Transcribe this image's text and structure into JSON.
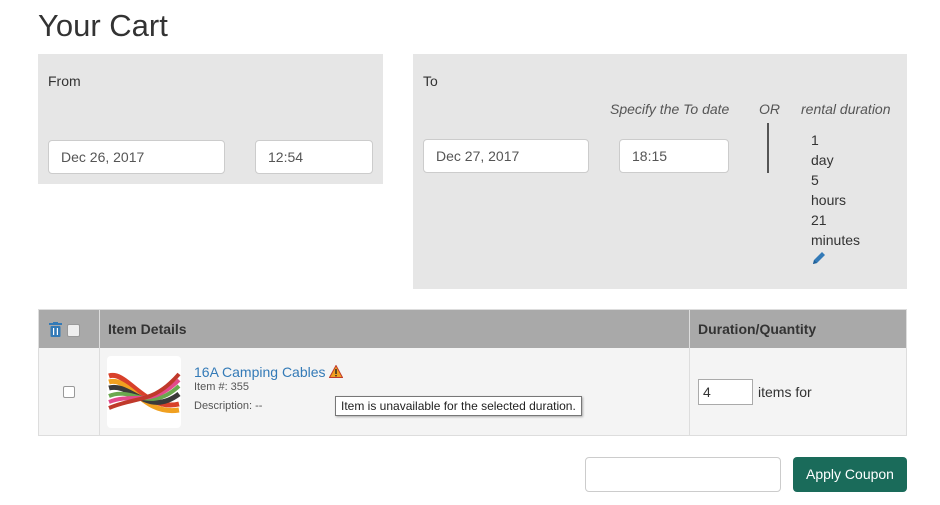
{
  "page": {
    "title": "Your Cart"
  },
  "from": {
    "label": "From",
    "date": "Dec 26, 2017",
    "time": "12:54"
  },
  "to": {
    "label": "To",
    "specify_label": "Specify the To date",
    "or_label": "OR",
    "duration_label": "rental duration",
    "date": "Dec 27, 2017",
    "time": "18:15",
    "duration": [
      "1",
      "day",
      "5",
      "hours",
      "21",
      "minutes"
    ]
  },
  "table": {
    "headers": {
      "details": "Item Details",
      "duration": "Duration/Quantity"
    },
    "rows": [
      {
        "name": "16A Camping Cables",
        "item_no": "Item #: 355",
        "description": "Description: --",
        "tooltip": "Item is unavailable for the selected duration.",
        "quantity": "4",
        "qty_suffix": "items for"
      }
    ]
  },
  "coupon": {
    "value": "",
    "button": "Apply Coupon"
  },
  "colors": {
    "accent": "#1a6b5a",
    "link": "#337ab7",
    "header": "#a9a9a9",
    "panel": "#e6e6e6"
  }
}
